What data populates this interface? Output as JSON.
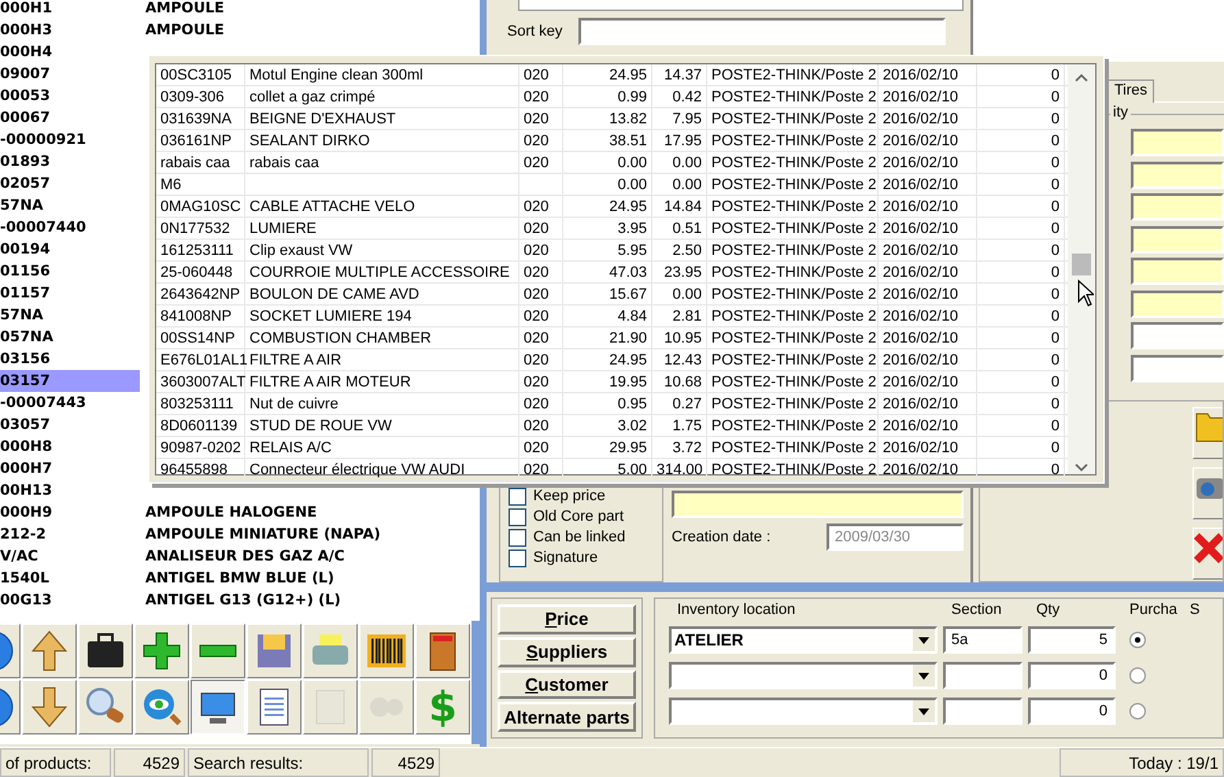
{
  "product_list": {
    "rows": [
      {
        "code": "000H1",
        "description": "AMPOULE",
        "selected": false
      },
      {
        "code": "000H3",
        "description": "AMPOULE",
        "selected": false
      },
      {
        "code": "000H4",
        "selected": false
      },
      {
        "code": "09007",
        "selected": false
      },
      {
        "code": "00053",
        "selected": false
      },
      {
        "code": "00067",
        "selected": false
      },
      {
        "code": "-00000921",
        "selected": false
      },
      {
        "code": "01893",
        "selected": false
      },
      {
        "code": "02057",
        "selected": false
      },
      {
        "code": "57NA",
        "selected": false
      },
      {
        "code": "-00007440",
        "selected": false
      },
      {
        "code": "00194",
        "selected": false
      },
      {
        "code": "01156",
        "selected": false
      },
      {
        "code": "01157",
        "selected": false
      },
      {
        "code": "57NA",
        "selected": false
      },
      {
        "code": "057NA",
        "selected": false
      },
      {
        "code": "03156",
        "selected": false
      },
      {
        "code": "03157",
        "selected": true
      },
      {
        "code": "-00007443",
        "selected": false
      },
      {
        "code": "03057",
        "selected": false
      },
      {
        "code": "000H8",
        "selected": false
      },
      {
        "code": "000H7",
        "selected": false
      },
      {
        "code": "00H13",
        "selected": false
      },
      {
        "code": "000H9",
        "description": "AMPOULE HALOGENE",
        "selected": false
      },
      {
        "code": "212-2",
        "description": "AMPOULE MINIATURE (NAPA)",
        "selected": false
      },
      {
        "code": "V/AC",
        "description": "ANALISEUR DES GAZ A/C",
        "selected": false
      },
      {
        "code": "1540L",
        "description": "ANTIGEL BMW BLUE (L)",
        "selected": false
      },
      {
        "code": "00G13",
        "description": "ANTIGEL G13 (G12+) (L)",
        "selected": false
      }
    ]
  },
  "toolbar": {
    "buttons": [
      {
        "kind": "globe",
        "pressed": false,
        "disabled": false
      },
      {
        "kind": "arrow-up",
        "pressed": false,
        "disabled": false
      },
      {
        "kind": "briefcase",
        "pressed": false,
        "disabled": false
      },
      {
        "kind": "plus",
        "pressed": false,
        "disabled": false
      },
      {
        "kind": "minus",
        "pressed": false,
        "disabled": false
      },
      {
        "kind": "floppy",
        "pressed": false,
        "disabled": false
      },
      {
        "kind": "printer",
        "pressed": false,
        "disabled": false
      },
      {
        "kind": "barcode",
        "pressed": false,
        "disabled": false
      },
      {
        "kind": "door",
        "pressed": false,
        "disabled": false
      },
      {
        "kind": "globe",
        "pressed": false,
        "disabled": false
      },
      {
        "kind": "arrow-down",
        "pressed": false,
        "disabled": false
      },
      {
        "kind": "magnifier",
        "pressed": false,
        "disabled": false
      },
      {
        "kind": "eye",
        "pressed": false,
        "disabled": false
      },
      {
        "kind": "monitor",
        "pressed": true,
        "disabled": false
      },
      {
        "kind": "notepad",
        "pressed": false,
        "disabled": false
      },
      {
        "kind": "map",
        "pressed": false,
        "disabled": true
      },
      {
        "kind": "gears",
        "pressed": false,
        "disabled": true
      },
      {
        "kind": "glyph",
        "glyph": "$",
        "pressed": false,
        "disabled": false
      }
    ]
  },
  "form": {
    "sort_key_label": "Sort key"
  },
  "side_panel": {
    "tabs": [
      {
        "label": "Tires",
        "selected": true
      }
    ],
    "group_label": "ity",
    "fields": [
      {
        "highlighted": true
      },
      {
        "highlighted": true
      },
      {
        "highlighted": true
      },
      {
        "highlighted": true
      },
      {
        "highlighted": true
      },
      {
        "highlighted": true
      },
      {
        "highlighted": false
      },
      {
        "highlighted": false
      }
    ],
    "actions": [
      {
        "kind": "folder"
      },
      {
        "kind": "camera"
      },
      {
        "kind": "delete"
      }
    ]
  },
  "options": [
    {
      "label": "Keep price",
      "checked": false
    },
    {
      "label": "Old Core part",
      "checked": false
    },
    {
      "label": "Can be linked",
      "checked": false
    },
    {
      "label": "Signature",
      "checked": false
    }
  ],
  "creation_date": {
    "label": "Creation date :",
    "value": "2009/03/30"
  },
  "nav_buttons": [
    {
      "accel": "P",
      "rest": "rice"
    },
    {
      "accel": "S",
      "rest": "uppliers"
    },
    {
      "accel": "C",
      "rest": "ustomer"
    },
    {
      "rest": "Alternate parts"
    }
  ],
  "inventory": {
    "columns": [
      "Inventory location",
      "Section",
      "Qty",
      "Purcha",
      "S"
    ],
    "rows": [
      {
        "location": "ATELIER",
        "section": "5a",
        "qty": "5",
        "selected": true
      },
      {
        "qty": "0",
        "selected": false
      },
      {
        "qty": "0",
        "selected": false
      }
    ]
  },
  "lookup_popup": {
    "rows": [
      [
        "00SC3105",
        "Motul Engine clean 300ml",
        "020",
        "24.95",
        "14.37",
        "POSTE2-THINK/Poste 2",
        "2016/02/10",
        "0"
      ],
      [
        "0309-306",
        "collet a gaz crimpé",
        "020",
        "0.99",
        "0.42",
        "POSTE2-THINK/Poste 2",
        "2016/02/10",
        "0"
      ],
      [
        "031639NA",
        "BEIGNE D'EXHAUST",
        "020",
        "13.82",
        "7.95",
        "POSTE2-THINK/Poste 2",
        "2016/02/10",
        "0"
      ],
      [
        "036161NP",
        "SEALANT DIRKO",
        "020",
        "38.51",
        "17.95",
        "POSTE2-THINK/Poste 2",
        "2016/02/10",
        "0"
      ],
      [
        "rabais caa",
        "rabais caa",
        "020",
        "0.00",
        "0.00",
        "POSTE2-THINK/Poste 2",
        "2016/02/10",
        "0"
      ],
      [
        "M6",
        "",
        "",
        "0.00",
        "0.00",
        "POSTE2-THINK/Poste 2",
        "2016/02/10",
        "0"
      ],
      [
        "0MAG10SC",
        "CABLE ATTACHE VELO",
        "020",
        "24.95",
        "14.84",
        "POSTE2-THINK/Poste 2",
        "2016/02/10",
        "0"
      ],
      [
        "0N177532",
        "LUMIERE",
        "020",
        "3.95",
        "0.51",
        "POSTE2-THINK/Poste 2",
        "2016/02/10",
        "0"
      ],
      [
        "161253111",
        "Clip exaust VW",
        "020",
        "5.95",
        "2.50",
        "POSTE2-THINK/Poste 2",
        "2016/02/10",
        "0"
      ],
      [
        "25-060448",
        "COURROIE MULTIPLE ACCESSOIRE",
        "020",
        "47.03",
        "23.95",
        "POSTE2-THINK/Poste 2",
        "2016/02/10",
        "0"
      ],
      [
        "2643642NP",
        "BOULON DE CAME AVD",
        "020",
        "15.67",
        "0.00",
        "POSTE2-THINK/Poste 2",
        "2016/02/10",
        "0"
      ],
      [
        "841008NP",
        "SOCKET LUMIERE 194",
        "020",
        "4.84",
        "2.81",
        "POSTE2-THINK/Poste 2",
        "2016/02/10",
        "0"
      ],
      [
        "00SS14NP",
        "COMBUSTION CHAMBER",
        "020",
        "21.90",
        "10.95",
        "POSTE2-THINK/Poste 2",
        "2016/02/10",
        "0"
      ],
      [
        "E676L01AL1",
        "FILTRE A AIR",
        "020",
        "24.95",
        "12.43",
        "POSTE2-THINK/Poste 2",
        "2016/02/10",
        "0"
      ],
      [
        "3603007ALT",
        "FILTRE A AIR MOTEUR",
        "020",
        "19.95",
        "10.68",
        "POSTE2-THINK/Poste 2",
        "2016/02/10",
        "0"
      ],
      [
        "803253111",
        "Nut de cuivre",
        "020",
        "0.95",
        "0.27",
        "POSTE2-THINK/Poste 2",
        "2016/02/10",
        "0"
      ],
      [
        "8D0601139",
        "STUD DE ROUE VW",
        "020",
        "3.02",
        "1.75",
        "POSTE2-THINK/Poste 2",
        "2016/02/10",
        "0"
      ],
      [
        "90987-0202",
        "RELAIS A/C",
        "020",
        "29.95",
        "3.72",
        "POSTE2-THINK/Poste 2",
        "2016/02/10",
        "0"
      ],
      [
        "96455898",
        "Connecteur électrique VW AUDI",
        "020",
        "5.00",
        "314.00",
        "POSTE2-THINK/Poste 2",
        "2016/02/10",
        "0"
      ]
    ]
  },
  "status_bar": [
    "of products:",
    "4529",
    "Search results:",
    "4529",
    "Today : 19/1"
  ]
}
